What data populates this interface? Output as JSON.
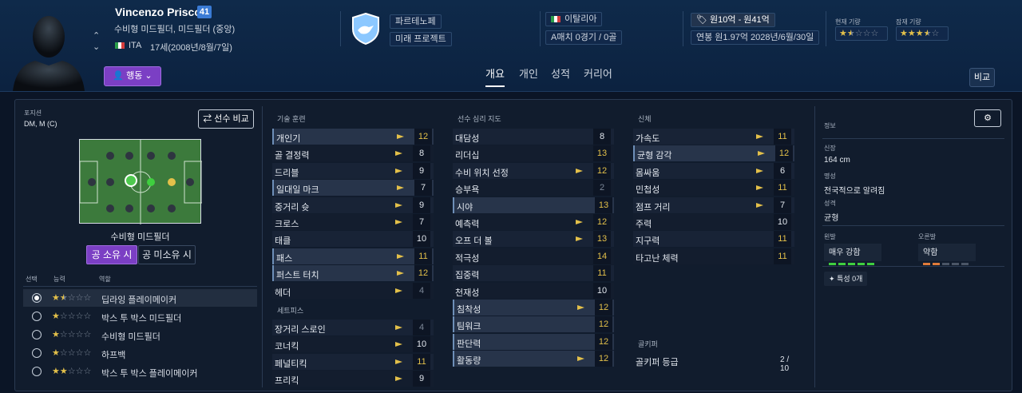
{
  "header": {
    "name": "Vincenzo Prisco",
    "ca": "41",
    "position": "수비형 미드필더, 미드필더 (중앙)",
    "nation_code": "ITA",
    "age": "17세(2008년/8월/7일)",
    "action_label": "행동",
    "club": "파르테노페",
    "club_status": "미래 프로젝트",
    "nation": "이탈리아",
    "caps": "A매치 0경기 / 0골",
    "value": "원10억 - 원41억",
    "contract": "연봉 원1.97억  2028년/6월/30일",
    "current_ability_label": "현재 기량",
    "current_ability_stars": 1.5,
    "potential_ability_label": "잠재 기량",
    "potential_ability_stars": 3.5,
    "tabs": [
      "개요",
      "개인",
      "성적",
      "커리어"
    ],
    "active_tab": 0,
    "compare_label": "비교"
  },
  "left": {
    "positions_label": "포지션",
    "positions_value": "DM, M (C)",
    "player_compare_label": "선수 비교",
    "role_label": "수비형 미드필더",
    "in_possession": "공 소유 시",
    "out_possession": "공 미소유 시",
    "col_select": "선택",
    "col_ability": "능력",
    "col_role": "역할",
    "roles": [
      {
        "stars": 1.5,
        "name": "딥라잉 플레이메이커",
        "selected": true
      },
      {
        "stars": 1,
        "name": "박스 투 박스 미드필더",
        "selected": false
      },
      {
        "stars": 1,
        "name": "수비형 미드필더",
        "selected": false
      },
      {
        "stars": 1,
        "name": "하프백",
        "selected": false
      },
      {
        "stars": 2,
        "name": "박스 투 박스 플레이메이커",
        "selected": false
      }
    ]
  },
  "technical": {
    "label": "기술 훈련",
    "attrs": [
      {
        "n": "개인기",
        "v": "12",
        "c": "#e3c04a",
        "hl": true,
        "up": true
      },
      {
        "n": "골 결정력",
        "v": "8",
        "c": "#e2e7ee",
        "hl": false,
        "up": true
      },
      {
        "n": "드리블",
        "v": "9",
        "c": "#e2e7ee",
        "hl": false,
        "up": true
      },
      {
        "n": "일대일 마크",
        "v": "7",
        "c": "#e2e7ee",
        "hl": true,
        "up": true
      },
      {
        "n": "중거리 슛",
        "v": "9",
        "c": "#e2e7ee",
        "hl": false,
        "up": true
      },
      {
        "n": "크로스",
        "v": "7",
        "c": "#e2e7ee",
        "hl": false,
        "up": true
      },
      {
        "n": "태클",
        "v": "10",
        "c": "#e2e7ee",
        "hl": false,
        "up": false
      },
      {
        "n": "패스",
        "v": "11",
        "c": "#e3c04a",
        "hl": true,
        "up": true
      },
      {
        "n": "퍼스트 터치",
        "v": "12",
        "c": "#e3c04a",
        "hl": true,
        "up": true
      },
      {
        "n": "헤더",
        "v": "4",
        "c": "#7c8797",
        "hl": false,
        "up": true
      }
    ],
    "set_label": "세트피스",
    "set_attrs": [
      {
        "n": "장거리 스로인",
        "v": "4",
        "c": "#7c8797",
        "hl": false,
        "up": true
      },
      {
        "n": "코너킥",
        "v": "10",
        "c": "#e2e7ee",
        "hl": false,
        "up": true
      },
      {
        "n": "페널티킥",
        "v": "11",
        "c": "#e3c04a",
        "hl": false,
        "up": true
      },
      {
        "n": "프리킥",
        "v": "9",
        "c": "#e2e7ee",
        "hl": false,
        "up": true
      }
    ]
  },
  "mental": {
    "label": "선수 심리 지도",
    "attrs": [
      {
        "n": "대담성",
        "v": "8",
        "c": "#e2e7ee",
        "hl": false,
        "up": false
      },
      {
        "n": "리더십",
        "v": "13",
        "c": "#e3c04a",
        "hl": false,
        "up": false
      },
      {
        "n": "수비 위치 선정",
        "v": "12",
        "c": "#e3c04a",
        "hl": false,
        "up": true
      },
      {
        "n": "승부욕",
        "v": "2",
        "c": "#7c8797",
        "hl": false,
        "up": false
      },
      {
        "n": "시야",
        "v": "13",
        "c": "#e3c04a",
        "hl": true,
        "up": false
      },
      {
        "n": "예측력",
        "v": "12",
        "c": "#e3c04a",
        "hl": false,
        "up": true
      },
      {
        "n": "오프 더 볼",
        "v": "13",
        "c": "#e3c04a",
        "hl": false,
        "up": true
      },
      {
        "n": "적극성",
        "v": "14",
        "c": "#e3c04a",
        "hl": false,
        "up": false
      },
      {
        "n": "집중력",
        "v": "11",
        "c": "#e3c04a",
        "hl": false,
        "up": false
      },
      {
        "n": "천재성",
        "v": "10",
        "c": "#e2e7ee",
        "hl": false,
        "up": false
      },
      {
        "n": "침착성",
        "v": "12",
        "c": "#e3c04a",
        "hl": true,
        "up": true
      },
      {
        "n": "팀워크",
        "v": "12",
        "c": "#e3c04a",
        "hl": true,
        "up": false
      },
      {
        "n": "판단력",
        "v": "12",
        "c": "#e3c04a",
        "hl": true,
        "up": false
      },
      {
        "n": "활동량",
        "v": "12",
        "c": "#e3c04a",
        "hl": true,
        "up": true
      }
    ]
  },
  "physical": {
    "label": "신체",
    "attrs": [
      {
        "n": "가속도",
        "v": "11",
        "c": "#e3c04a",
        "hl": false,
        "up": true
      },
      {
        "n": "균형 감각",
        "v": "12",
        "c": "#e3c04a",
        "hl": true,
        "up": true
      },
      {
        "n": "몸싸움",
        "v": "6",
        "c": "#e2e7ee",
        "hl": false,
        "up": true
      },
      {
        "n": "민첩성",
        "v": "11",
        "c": "#e3c04a",
        "hl": false,
        "up": true
      },
      {
        "n": "점프 거리",
        "v": "7",
        "c": "#e2e7ee",
        "hl": false,
        "up": true
      },
      {
        "n": "주력",
        "v": "10",
        "c": "#e2e7ee",
        "hl": false,
        "up": false
      },
      {
        "n": "지구력",
        "v": "11",
        "c": "#e3c04a",
        "hl": false,
        "up": false
      },
      {
        "n": "타고난 체력",
        "v": "11",
        "c": "#e3c04a",
        "hl": false,
        "up": false
      }
    ],
    "gk_label": "골키퍼",
    "gk_name": "골키퍼 등급",
    "gk_value": "2 / 10"
  },
  "info": {
    "label": "정보",
    "height_label": "신장",
    "height": "164 cm",
    "fame_label": "명성",
    "fame": "전국적으로 알려짐",
    "personality_label": "성격",
    "personality": "균형",
    "left_foot_label": "왼발",
    "left_foot": "매우 강함",
    "left_foot_level": 5,
    "right_foot_label": "오른발",
    "right_foot": "약함",
    "right_foot_level": 2,
    "traits": "특성 0개"
  }
}
